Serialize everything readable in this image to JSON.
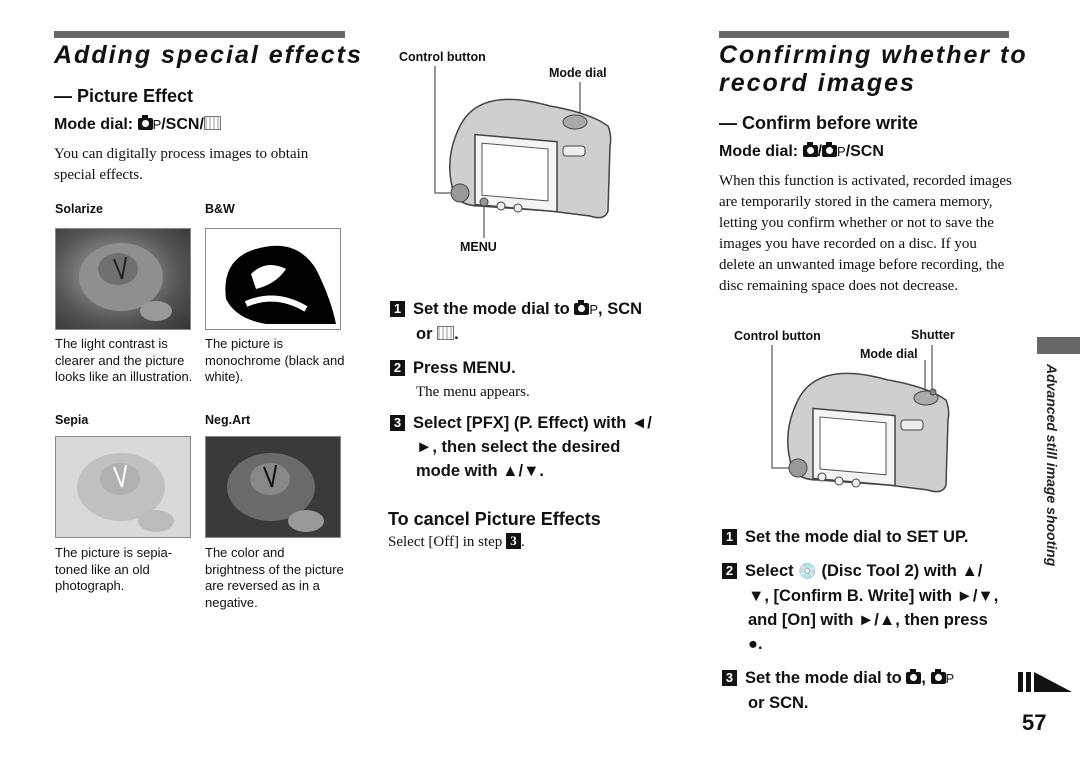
{
  "left": {
    "title": "Adding special effects",
    "subtitle": "— Picture Effect",
    "mode_dial_prefix": "Mode dial:",
    "mode_dial_p": "P",
    "mode_dial_suffix": "/SCN/",
    "intro": "You can digitally process images to obtain special effects.",
    "effects": [
      {
        "label": "Solarize",
        "caption": "The light contrast is clearer and the picture looks like an illustration."
      },
      {
        "label": "B&W",
        "caption": "The picture is monochrome (black and white)."
      },
      {
        "label": "Sepia",
        "caption": "The picture is sepia-toned like an old photograph."
      },
      {
        "label": "Neg.Art",
        "caption": "The color and brightness of the picture are reversed as in a negative."
      }
    ]
  },
  "middle": {
    "callouts": {
      "control_button": "Control button",
      "mode_dial": "Mode dial",
      "menu": "MENU"
    },
    "steps": [
      {
        "num": "1",
        "text_a": "Set the mode dial to",
        "text_p": "P",
        "text_b": ", SCN",
        "text_c": "or",
        "text_d": "."
      },
      {
        "num": "2",
        "text": "Press MENU.",
        "sub": "The menu appears."
      },
      {
        "num": "3",
        "line1": "Select [PFX] (P. Effect) with ◄/",
        "line2": "►, then select the desired",
        "line3": "mode with ▲/▼."
      }
    ],
    "cancel_heading": "To cancel Picture Effects",
    "cancel_text": "Select [Off] in step",
    "cancel_step": "3",
    "cancel_end": "."
  },
  "right": {
    "title_line1": "Confirming whether to",
    "title_line2": "record images",
    "subtitle": "— Confirm before write",
    "mode_dial_prefix": "Mode dial:",
    "mode_dial_p": "P",
    "mode_dial_suffix": "/SCN",
    "intro": "When this function is activated, recorded images are temporarily stored in the camera memory, letting you confirm whether or not to save the images you have recorded on a disc. If you delete an unwanted image before recording, the disc remaining space does not decrease.",
    "callouts": {
      "control_button": "Control button",
      "shutter": "Shutter",
      "mode_dial": "Mode dial"
    },
    "steps": [
      {
        "num": "1",
        "text": "Set the mode dial to SET UP."
      },
      {
        "num": "2",
        "line1a": "Select",
        "line1b": "(Disc Tool 2) with ▲/",
        "line2": "▼, [Confirm B. Write] with ►/▼,",
        "line3": "and [On] with ►/▲, then press",
        "line4": "●."
      },
      {
        "num": "3",
        "line1a": "Set the mode dial to",
        "line1p": "P",
        "line2": "or SCN."
      }
    ]
  },
  "side_tab": "Advanced still image shooting",
  "page_number": "57"
}
